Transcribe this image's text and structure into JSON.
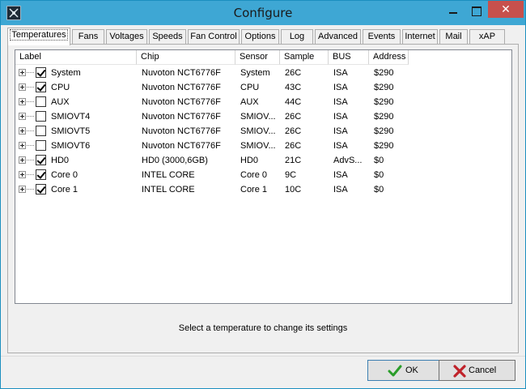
{
  "window": {
    "title": "Configure"
  },
  "tabs": [
    {
      "label": "Temperatures",
      "active": true
    },
    {
      "label": "Fans"
    },
    {
      "label": "Voltages"
    },
    {
      "label": "Speeds"
    },
    {
      "label": "Fan Control"
    },
    {
      "label": "Options"
    },
    {
      "label": "Log"
    },
    {
      "label": "Advanced"
    },
    {
      "label": "Events"
    },
    {
      "label": "Internet"
    },
    {
      "label": "Mail"
    },
    {
      "label": "xAP"
    }
  ],
  "table": {
    "columns": [
      "Label",
      "Chip",
      "Sensor",
      "Sample",
      "BUS",
      "Address"
    ],
    "rows": [
      {
        "checked": true,
        "label": "System",
        "chip": "Nuvoton NCT6776F",
        "sensor": "System",
        "sample": "26C",
        "bus": "ISA",
        "address": "$290"
      },
      {
        "checked": true,
        "label": "CPU",
        "chip": "Nuvoton NCT6776F",
        "sensor": "CPU",
        "sample": "43C",
        "bus": "ISA",
        "address": "$290"
      },
      {
        "checked": false,
        "label": "AUX",
        "chip": "Nuvoton NCT6776F",
        "sensor": "AUX",
        "sample": "44C",
        "bus": "ISA",
        "address": "$290"
      },
      {
        "checked": false,
        "label": "SMIOVT4",
        "chip": "Nuvoton NCT6776F",
        "sensor": "SMIOV...",
        "sample": "26C",
        "bus": "ISA",
        "address": "$290"
      },
      {
        "checked": false,
        "label": "SMIOVT5",
        "chip": "Nuvoton NCT6776F",
        "sensor": "SMIOV...",
        "sample": "26C",
        "bus": "ISA",
        "address": "$290"
      },
      {
        "checked": false,
        "label": "SMIOVT6",
        "chip": "Nuvoton NCT6776F",
        "sensor": "SMIOV...",
        "sample": "26C",
        "bus": "ISA",
        "address": "$290"
      },
      {
        "checked": true,
        "label": "HD0",
        "chip": "HD0 (3000,6GB)",
        "sensor": "HD0",
        "sample": "21C",
        "bus": "AdvS...",
        "address": "$0"
      },
      {
        "checked": true,
        "label": "Core 0",
        "chip": "INTEL CORE",
        "sensor": "Core 0",
        "sample": "9C",
        "bus": "ISA",
        "address": "$0"
      },
      {
        "checked": true,
        "label": "Core 1",
        "chip": "INTEL CORE",
        "sensor": "Core 1",
        "sample": "10C",
        "bus": "ISA",
        "address": "$0"
      }
    ]
  },
  "status_text": "Select a temperature to change its settings",
  "buttons": {
    "ok": "OK",
    "cancel": "Cancel"
  },
  "colors": {
    "titlebar": "#3ea7d4",
    "close": "#c7504c",
    "ok_check": "#2a9d2a",
    "cancel_x": "#c0222a"
  }
}
